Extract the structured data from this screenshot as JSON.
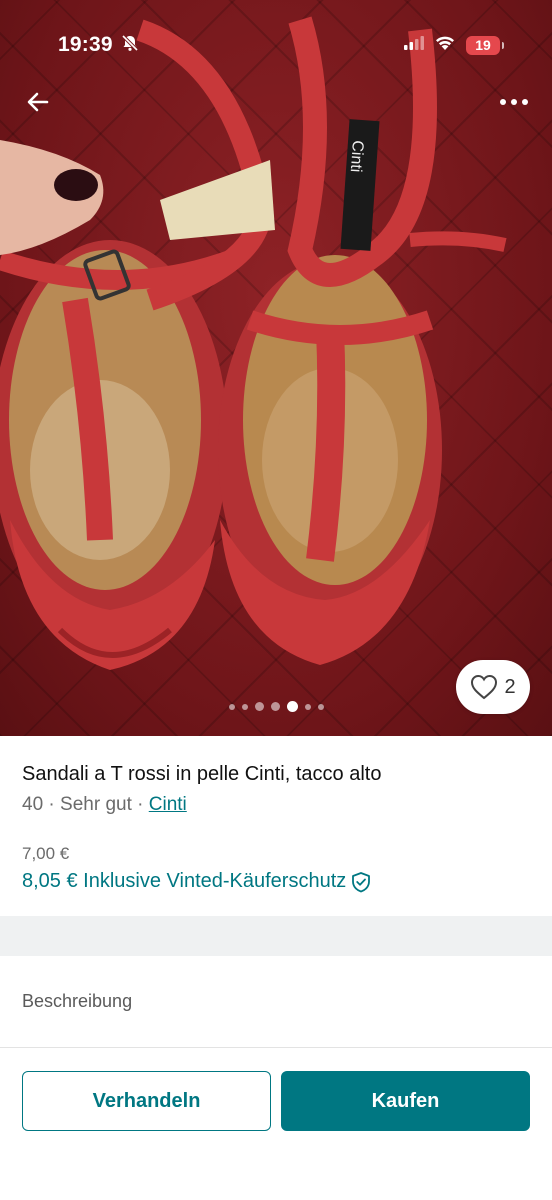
{
  "status_bar": {
    "time": "19:39",
    "battery_level": "19"
  },
  "photo": {
    "label_text": "Cinti",
    "like_count": "2",
    "carousel": {
      "total": 7,
      "active_index": 4
    }
  },
  "listing": {
    "title": "Sandali a T rossi in pelle Cinti, tacco alto",
    "size": "40",
    "separator": "·",
    "condition": "Sehr gut",
    "brand": "Cinti",
    "price": "7,00 €",
    "total_price_text": "8,05 € Inklusive Vinted-Käuferschutz"
  },
  "description": {
    "label": "Beschreibung"
  },
  "actions": {
    "negotiate_label": "Verhandeln",
    "buy_label": "Kaufen"
  },
  "colors": {
    "accent": "#007782",
    "battery": "#e5484d",
    "fabric": "#7a1a1e",
    "leather": "#c8383a"
  },
  "icons": {
    "back": "arrow-left-icon",
    "more": "more-dots-icon",
    "like": "heart-icon",
    "protection": "shield-check-icon",
    "bell_off": "bell-slash-icon",
    "signal": "signal-icon",
    "wifi": "wifi-icon"
  }
}
